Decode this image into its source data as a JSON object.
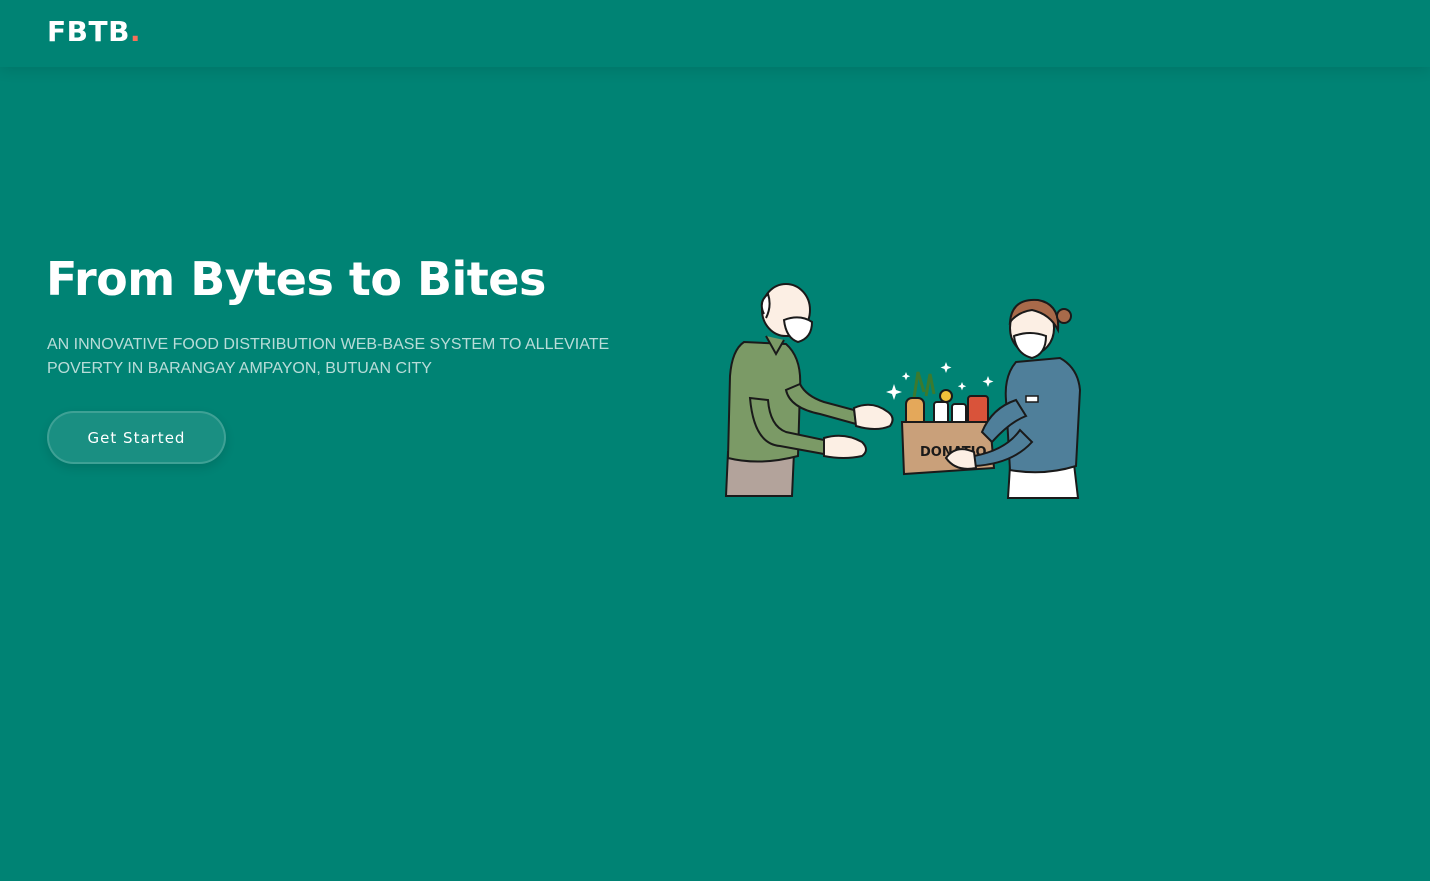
{
  "header": {
    "logo_text": "FBTB",
    "logo_dot": "."
  },
  "hero": {
    "title": "From Bytes to Bites",
    "subtitle": "AN INNOVATIVE FOOD DISTRIBUTION WEB-BASE SYSTEM TO ALLEVIATE POVERTY IN BARANGAY AMPAYON, BUTUAN CITY",
    "cta_label": "Get Started",
    "illustration": {
      "icon": "food-donation-illustration",
      "box_label": "DONATIO"
    }
  },
  "colors": {
    "background": "#008374",
    "logo_accent": "#f96f59",
    "text": "#ffffff"
  }
}
